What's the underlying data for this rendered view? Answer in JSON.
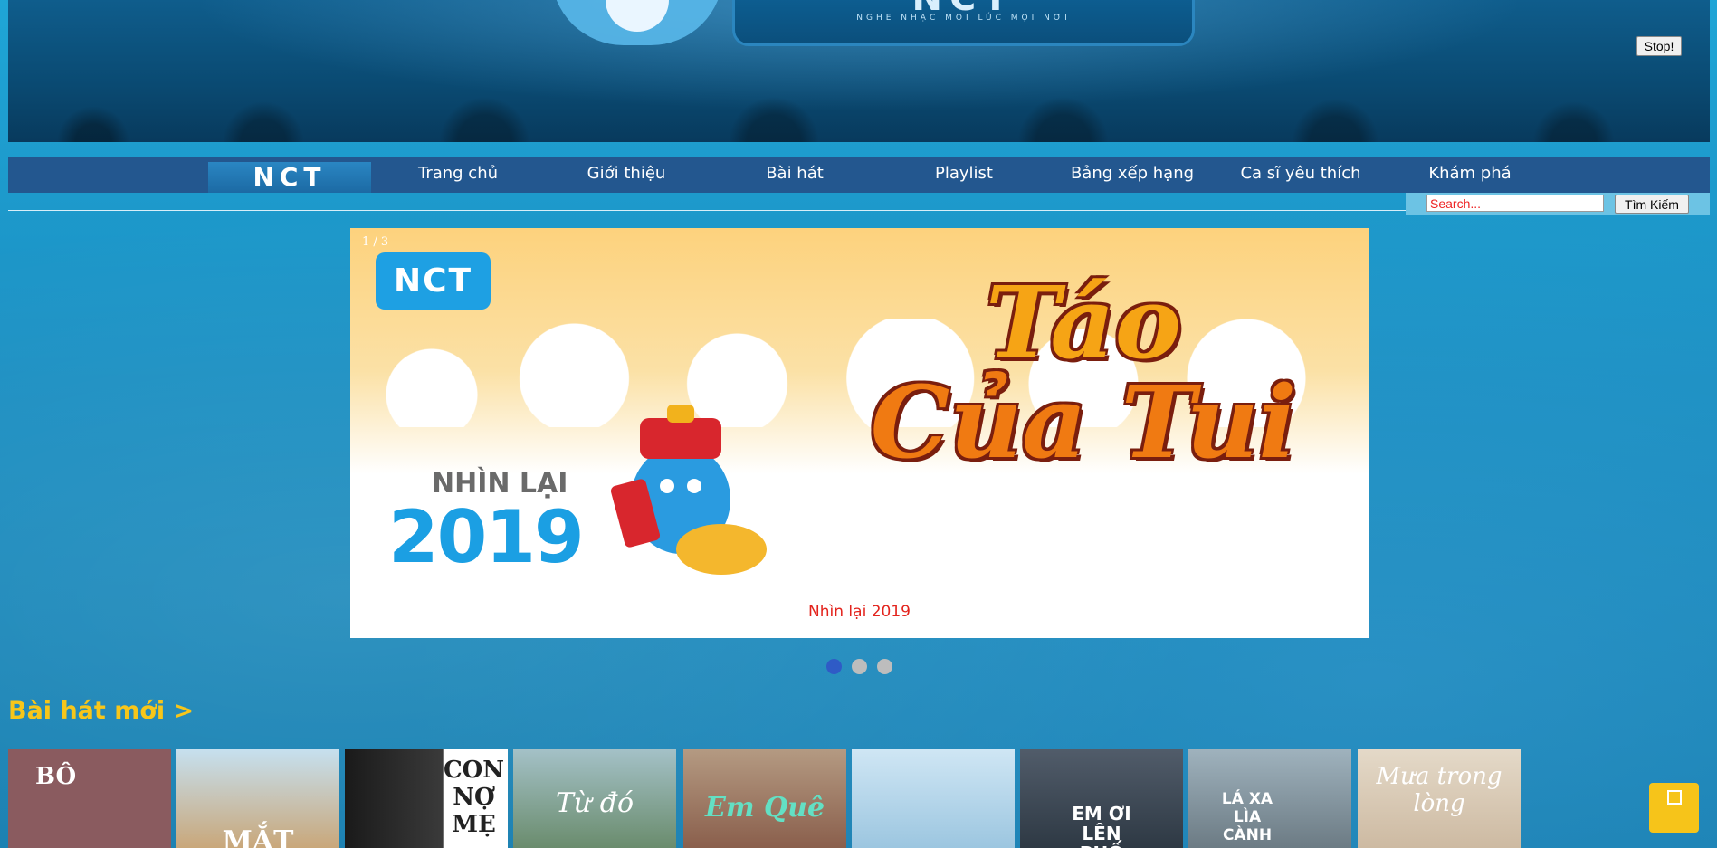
{
  "header": {
    "logo_text": "NCT",
    "slogan": "NGHE NHẠC MỌI LÚC MỌI NƠI",
    "stop_label": "Stop!"
  },
  "nav": {
    "logo_text": "NCT",
    "items": [
      {
        "label": "Trang chủ"
      },
      {
        "label": "Giới thiệu"
      },
      {
        "label": "Bài hát"
      },
      {
        "label": "Playlist"
      },
      {
        "label": "Bảng xếp hạng"
      },
      {
        "label": "Ca sĩ yêu thích"
      },
      {
        "label": "Khám phá"
      }
    ]
  },
  "search": {
    "placeholder": "Search...",
    "button_label": "Tìm Kiếm"
  },
  "slideshow": {
    "counter": "1 / 3",
    "logo_text": "NCT",
    "nhin_lai": "NHÌN LẠI",
    "year": "2019",
    "title_line1": "Táo",
    "title_line2": "Của Tui",
    "caption": "Nhìn lại 2019",
    "dots": 3,
    "active_dot": 1
  },
  "songs_section": {
    "title": "Bài hát mới >",
    "thumbnails": [
      {
        "text": "BÔ",
        "color": "#8a5b5f"
      },
      {
        "text": "MẮT",
        "color": "#c9a77a"
      },
      {
        "text": "CON NỢ MẸ",
        "color": "#2a2a2a"
      },
      {
        "text": "Từ đó",
        "color": "#6a8c6d"
      },
      {
        "text": "Em Quê",
        "color": "#8a5f4c"
      },
      {
        "text": "",
        "color": "#9cc6e0"
      },
      {
        "text": "EM ƠI LÊN PHỐ",
        "color": "#3a4654"
      },
      {
        "text": "LÁ XA LÌA CÀNH",
        "color": "#6c7b84"
      },
      {
        "text": "Mưa trong lòng",
        "color": "#d9cab6"
      }
    ]
  },
  "colors": {
    "page_bg": "#1b8fc2",
    "navbar": "#23578f",
    "section_title": "#f7c61a",
    "caption": "#e3231c",
    "active_dot": "#2f5bc6",
    "chat_button": "#f6c41a"
  },
  "icons": {
    "chat": "chat-icon"
  }
}
